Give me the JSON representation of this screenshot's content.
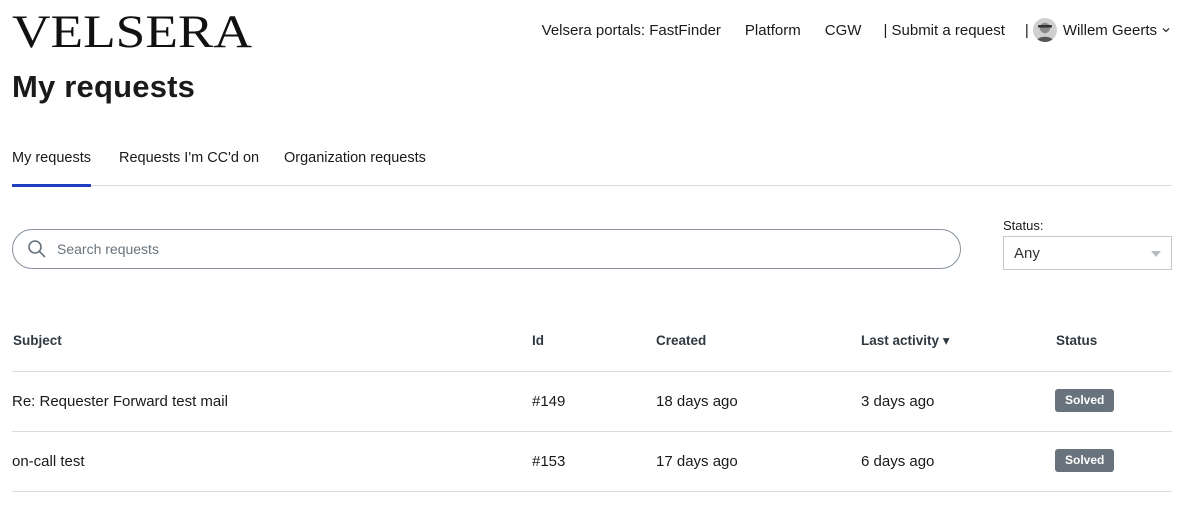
{
  "header": {
    "logo_text": "VELSERA",
    "nav": {
      "portals": "Velsera portals: FastFinder",
      "platform": "Platform",
      "cgw": "CGW",
      "submit": "| Submit a request",
      "pipe": "|",
      "user_name": "Willem Geerts"
    }
  },
  "page": {
    "title": "My requests"
  },
  "tabs": [
    {
      "label": "My requests",
      "active": true
    },
    {
      "label": "Requests I'm CC'd on",
      "active": false
    },
    {
      "label": "Organization requests",
      "active": false
    }
  ],
  "search": {
    "placeholder": "Search requests"
  },
  "status_filter": {
    "label": "Status:",
    "selected": "Any"
  },
  "table": {
    "headers": {
      "subject": "Subject",
      "id": "Id",
      "created": "Created",
      "last_activity": "Last activity ▾",
      "status": "Status"
    },
    "rows": [
      {
        "subject": "Re: Requester Forward test mail",
        "id": "#149",
        "created": "18 days ago",
        "last_activity": "3 days ago",
        "status": "Solved"
      },
      {
        "subject": "on-call test",
        "id": "#153",
        "created": "17 days ago",
        "last_activity": "6 days ago",
        "status": "Solved"
      }
    ]
  },
  "colors": {
    "tab_active": "#1f3fbf",
    "badge": "#68737d"
  }
}
